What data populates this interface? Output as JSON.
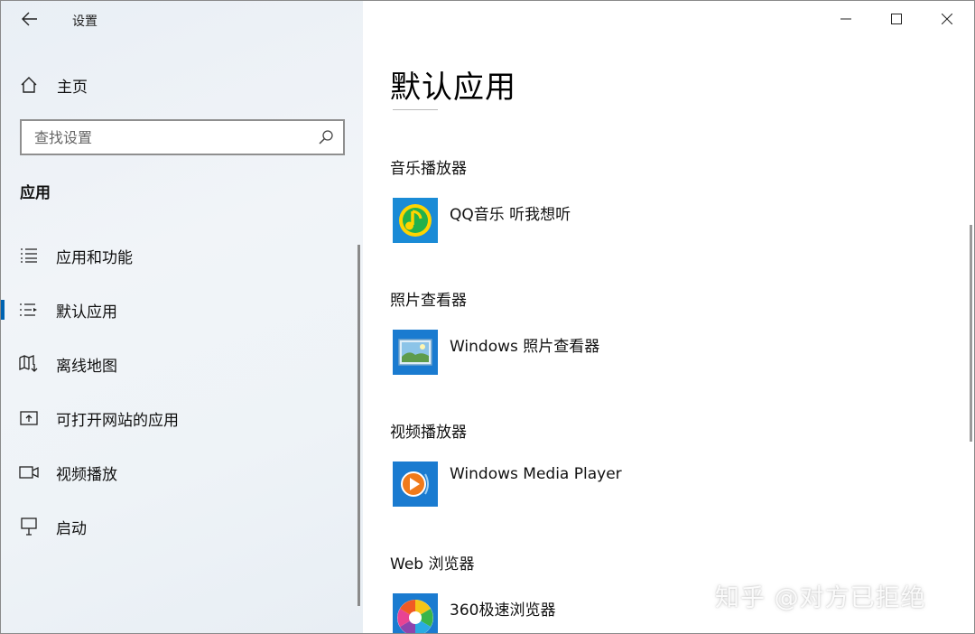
{
  "window": {
    "title": "设置"
  },
  "sidebar": {
    "home_label": "主页",
    "search_placeholder": "查找设置",
    "section_title": "应用",
    "items": [
      {
        "label": "应用和功能",
        "icon": "list-icon",
        "selected": false
      },
      {
        "label": "默认应用",
        "icon": "default-list-icon",
        "selected": true
      },
      {
        "label": "离线地图",
        "icon": "map-download-icon",
        "selected": false
      },
      {
        "label": "可打开网站的应用",
        "icon": "open-web-icon",
        "selected": false
      },
      {
        "label": "视频播放",
        "icon": "video-icon",
        "selected": false
      },
      {
        "label": "启动",
        "icon": "startup-icon",
        "selected": false
      }
    ],
    "selected_color": "#0063b1"
  },
  "main": {
    "page_title": "默认应用",
    "categories": [
      {
        "label": "音乐播放器",
        "app": "QQ音乐 听我想听",
        "icon": "qq-music-icon"
      },
      {
        "label": "照片查看器",
        "app": "Windows 照片查看器",
        "icon": "photo-viewer-icon"
      },
      {
        "label": "视频播放器",
        "app": "Windows Media Player",
        "icon": "media-player-icon"
      },
      {
        "label": "Web 浏览器",
        "app": "360极速浏览器",
        "icon": "browser-360-icon"
      }
    ]
  },
  "watermark": "知乎 @对方已拒绝"
}
